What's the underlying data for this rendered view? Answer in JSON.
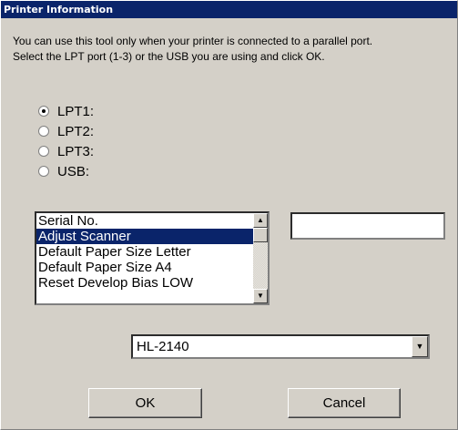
{
  "window": {
    "title": "Printer Information"
  },
  "description": {
    "line1": "You can use this tool only when your printer is connected to a parallel port.",
    "line2": "Select the LPT port (1-3) or the USB you are using and click OK."
  },
  "ports": [
    {
      "label": "LPT1:",
      "selected": true
    },
    {
      "label": "LPT2:",
      "selected": false
    },
    {
      "label": "LPT3:",
      "selected": false
    },
    {
      "label": "USB:",
      "selected": false
    }
  ],
  "settings_list": {
    "items": [
      "Serial No.",
      "Adjust Scanner",
      "Default Paper Size Letter",
      "Default Paper Size A4",
      "Reset Develop Bias LOW"
    ],
    "selected": "Adjust Scanner",
    "scroll_up_icon": "scroll-up-arrow",
    "scroll_down_icon": "scroll-down-arrow"
  },
  "value_field": {
    "value": ""
  },
  "model_select": {
    "value": "HL-2140",
    "icon": "dropdown-arrow"
  },
  "buttons": {
    "ok": "OK",
    "cancel": "Cancel"
  },
  "colors": {
    "titlebar": "#0a246a",
    "face": "#d4d0c8",
    "selection": "#0a246a"
  }
}
